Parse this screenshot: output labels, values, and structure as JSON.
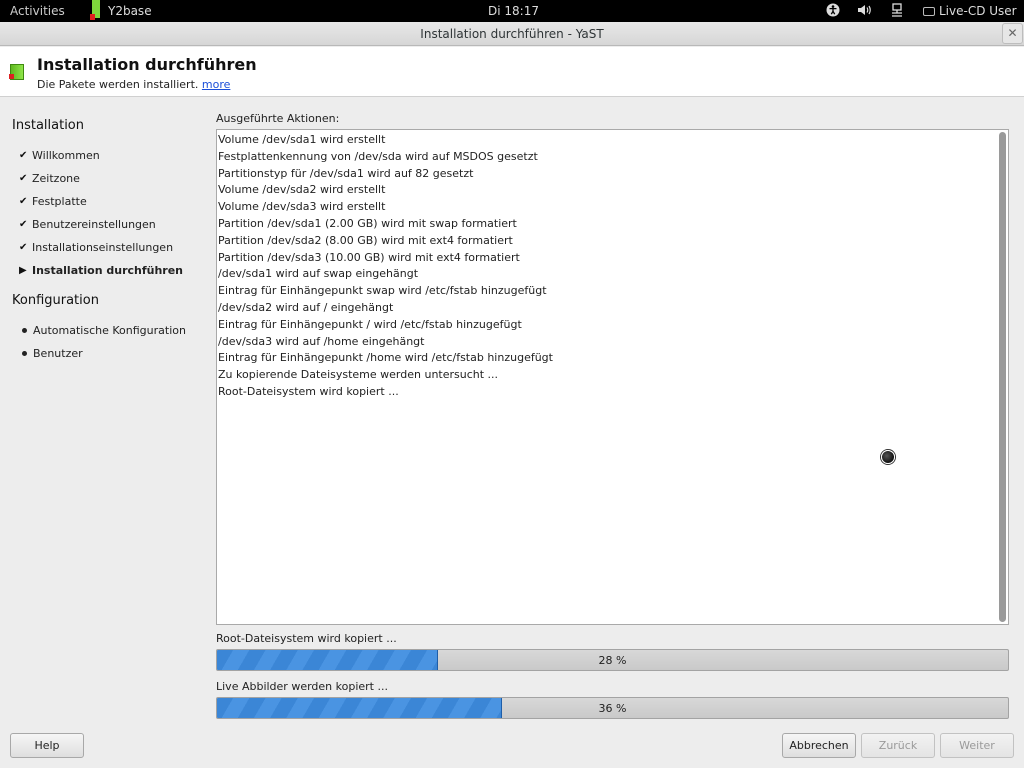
{
  "top_panel": {
    "activities": "Activities",
    "app_label": "Y2base",
    "clock": "Di 18:17",
    "user": "Live-CD User"
  },
  "window": {
    "title": "Installation durchführen - YaST",
    "close": "✕"
  },
  "header": {
    "title": "Installation durchführen",
    "subtitle": "Die Pakete werden installiert.",
    "more_link": "more"
  },
  "sidebar": {
    "sections": [
      {
        "title": "Installation",
        "items": [
          {
            "label": "Willkommen",
            "state": "done"
          },
          {
            "label": "Zeitzone",
            "state": "done"
          },
          {
            "label": "Festplatte",
            "state": "done"
          },
          {
            "label": "Benutzereinstellungen",
            "state": "done"
          },
          {
            "label": "Installationseinstellungen",
            "state": "done"
          },
          {
            "label": "Installation durchführen",
            "state": "current"
          }
        ]
      },
      {
        "title": "Konfiguration",
        "items": [
          {
            "label": "Automatische Konfiguration",
            "state": "pending"
          },
          {
            "label": "Benutzer",
            "state": "pending"
          }
        ]
      }
    ]
  },
  "log": {
    "label": "Ausgeführte Aktionen:",
    "lines": [
      "Volume /dev/sda1 wird erstellt",
      "Festplattenkennung von /dev/sda wird auf MSDOS gesetzt",
      "Partitionstyp für /dev/sda1 wird auf 82 gesetzt",
      "Volume /dev/sda2 wird erstellt",
      "Volume /dev/sda3 wird erstellt",
      "Partition /dev/sda1 (2.00 GB) wird mit swap formatiert",
      "Partition /dev/sda2 (8.00 GB) wird mit ext4 formatiert",
      "Partition /dev/sda3 (10.00 GB) wird mit ext4 formatiert",
      "/dev/sda1 wird auf swap eingehängt",
      "Eintrag für Einhängepunkt swap wird /etc/fstab hinzugefügt",
      "/dev/sda2 wird auf / eingehängt",
      "Eintrag für Einhängepunkt / wird /etc/fstab hinzugefügt",
      "/dev/sda3 wird auf /home eingehängt",
      "Eintrag für Einhängepunkt /home wird /etc/fstab hinzugefügt",
      "Zu kopierende Dateisysteme werden untersucht ...",
      "Root-Dateisystem wird kopiert ..."
    ]
  },
  "progress": [
    {
      "label": "Root-Dateisystem wird kopiert ...",
      "value": 28,
      "text": "28 %"
    },
    {
      "label": "Live Abbilder werden kopiert ...",
      "value": 36,
      "text": "36 %"
    }
  ],
  "buttons": {
    "help": "Help",
    "abort": "Abbrechen",
    "back": "Zurück",
    "next": "Weiter"
  }
}
